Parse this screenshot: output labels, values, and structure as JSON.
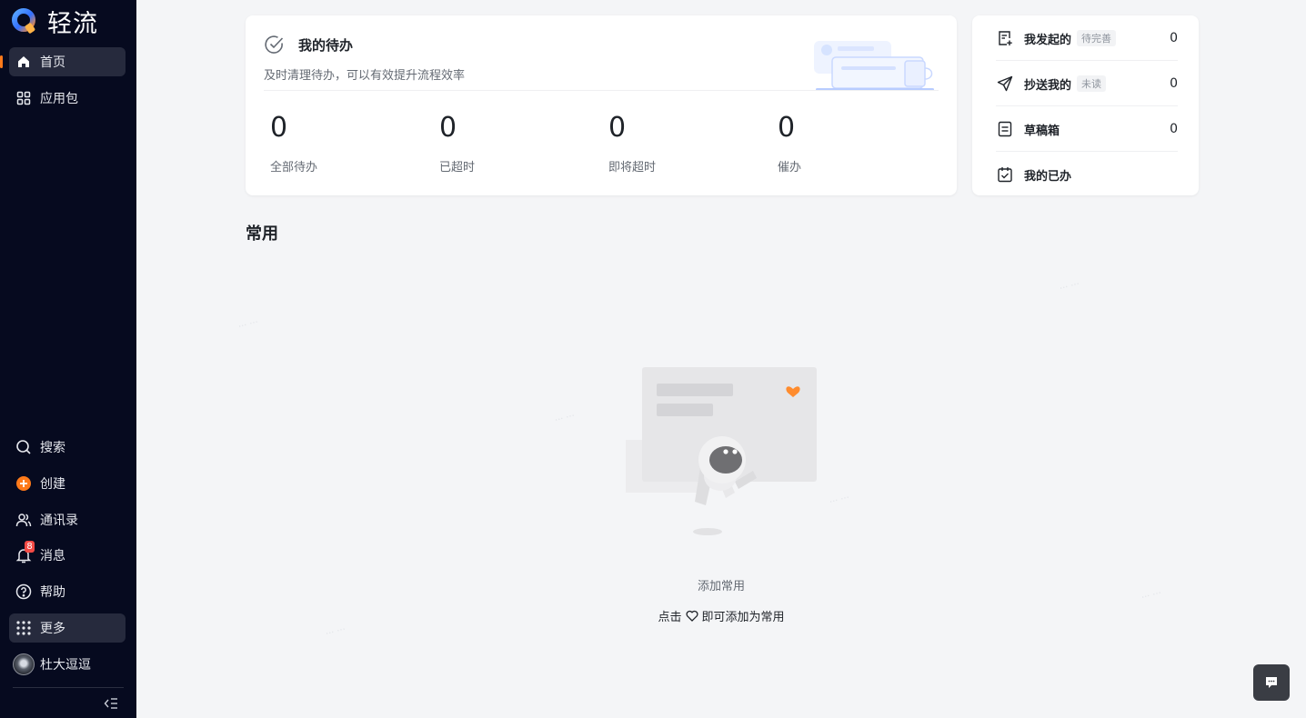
{
  "app": {
    "name": "轻流"
  },
  "sidebar": {
    "top_items": [
      {
        "label": "首页",
        "icon": "home-icon"
      },
      {
        "label": "应用包",
        "icon": "grid-icon"
      }
    ],
    "bottom_items": [
      {
        "label": "搜索",
        "icon": "search-icon"
      },
      {
        "label": "创建",
        "icon": "plus-circle-icon"
      },
      {
        "label": "通讯录",
        "icon": "contacts-icon"
      },
      {
        "label": "消息",
        "icon": "bell-icon",
        "badge": "8"
      },
      {
        "label": "帮助",
        "icon": "help-icon"
      },
      {
        "label": "更多",
        "icon": "apps-icon"
      }
    ],
    "user": {
      "name": "杜大逗逗"
    }
  },
  "todo": {
    "title": "我的待办",
    "subtitle": "及时清理待办，可以有效提升流程效率",
    "stats": [
      {
        "value": "0",
        "label": "全部待办"
      },
      {
        "value": "0",
        "label": "已超时"
      },
      {
        "value": "0",
        "label": "即将超时"
      },
      {
        "value": "0",
        "label": "催办"
      }
    ]
  },
  "side_panel": {
    "rows": [
      {
        "label": "我发起的",
        "tag": "待完善",
        "count": "0",
        "icon": "doc-plus-icon"
      },
      {
        "label": "抄送我的",
        "tag": "未读",
        "count": "0",
        "icon": "send-icon"
      },
      {
        "label": "草稿箱",
        "tag": "",
        "count": "0",
        "icon": "draft-icon"
      },
      {
        "label": "我的已办",
        "tag": "",
        "count": "",
        "icon": "done-calendar-icon"
      }
    ]
  },
  "common": {
    "title": "常用",
    "empty_title": "添加常用",
    "hint_prefix": "点击",
    "hint_suffix": "即可添加为常用"
  },
  "colors": {
    "sidebar_bg": "#060a1f",
    "accent": "#ff7a1a",
    "badge": "#f54a45",
    "brand_blue": "#3370ff"
  }
}
